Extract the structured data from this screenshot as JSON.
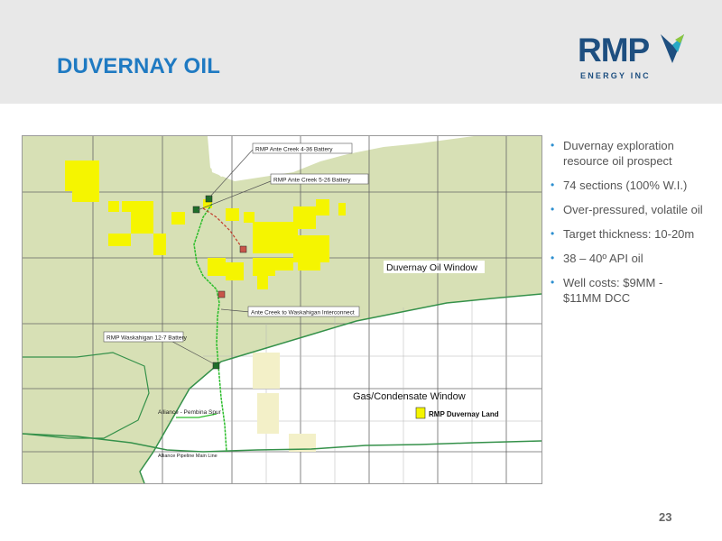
{
  "slide": {
    "title": "DUVERNAY OIL",
    "page_number": "23"
  },
  "logo": {
    "name": "RMP",
    "subtitle": "ENERGY INC"
  },
  "map": {
    "labels": {
      "battery_4_36": "RMP Ante Creek 4-36 Battery",
      "battery_5_26": "RMP Ante Creek 5-26 Battery",
      "interconnect": "Ante Creek to Waskahigan Interconnect",
      "battery_12_7": "RMP Waskahigan 12-7 Battery",
      "oil_window": "Duvernay Oil Window",
      "gas_window": "Gas/Condensate Window",
      "legend_land": "RMP Duvernay Land",
      "alliance_spur": "Alliance - Pembina Spur",
      "alliance_mainline": "Alliance Pipeline Main Line"
    },
    "colors": {
      "oil_window": "#d7e0b5",
      "land": "#f5f500",
      "pipeline": "#2bbd2b",
      "boundary": "#35914a",
      "grid": "#666666"
    }
  },
  "bullets": [
    "Duvernay exploration resource oil prospect",
    "74 sections (100% W.I.)",
    "Over-pressured, volatile oil",
    "Target thickness: 10-20m",
    "38 – 40º API oil",
    "Well costs: $9MM - $11MM DCC"
  ],
  "colors": {
    "title": "#1f7ac2",
    "logo": "#1e4f80",
    "bullet_marker": "#2d8fd0"
  }
}
